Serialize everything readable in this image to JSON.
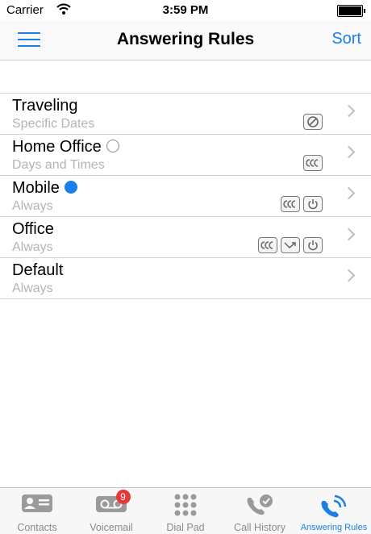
{
  "status_bar": {
    "carrier": "Carrier",
    "time": "3:59 PM"
  },
  "nav": {
    "title": "Answering Rules",
    "sort_label": "Sort",
    "menu_icon": "hamburger-menu-icon"
  },
  "colors": {
    "accent": "#1a80e6",
    "badge_red": "#e53935",
    "subtitle_gray": "#b4b4b4"
  },
  "rules": [
    {
      "name": "Traveling",
      "subtitle": "Specific Dates",
      "status": "none",
      "icons": [
        "blocked-icon"
      ]
    },
    {
      "name": "Home Office",
      "subtitle": "Days and Times",
      "status": "inactive",
      "icons": [
        "ring-group-icon"
      ]
    },
    {
      "name": "Mobile",
      "subtitle": "Always",
      "status": "active",
      "icons": [
        "ring-group-icon",
        "power-icon"
      ]
    },
    {
      "name": "Office",
      "subtitle": "Always",
      "status": "none",
      "icons": [
        "ring-group-icon",
        "forward-icon",
        "power-icon"
      ]
    },
    {
      "name": "Default",
      "subtitle": "Always",
      "status": "none",
      "icons": []
    }
  ],
  "tabs": [
    {
      "label": "Contacts",
      "icon": "contact-card-icon",
      "active": false
    },
    {
      "label": "Voicemail",
      "icon": "voicemail-icon",
      "active": false,
      "badge": "9"
    },
    {
      "label": "Dial Pad",
      "icon": "dial-pad-icon",
      "active": false
    },
    {
      "label": "Call History",
      "icon": "call-history-icon",
      "active": false
    },
    {
      "label": "Answering Rules",
      "icon": "answering-rules-icon",
      "active": true
    }
  ]
}
